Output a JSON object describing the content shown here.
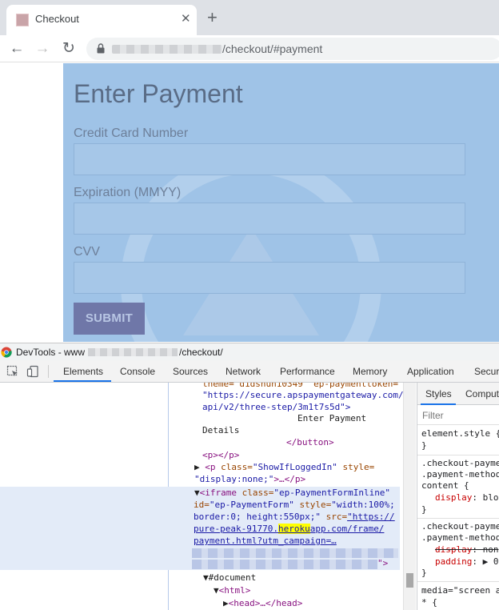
{
  "browser": {
    "tab_title": "Checkout",
    "tab_close": "✕",
    "new_tab": "+",
    "url_path": "/checkout/#payment",
    "nav_back": "←",
    "nav_forward": "→",
    "nav_reload": "↻"
  },
  "page": {
    "title": "Enter Payment",
    "fields": [
      {
        "label": "Credit Card Number",
        "value": ""
      },
      {
        "label": "Expiration (MMYY)",
        "value": ""
      },
      {
        "label": "CVV",
        "value": ""
      }
    ],
    "submit_label": "SUBMIT"
  },
  "devtools": {
    "title_prefix": "DevTools - www",
    "title_suffix": "/checkout/",
    "tabs": [
      "Elements",
      "Console",
      "Sources",
      "Network",
      "Performance",
      "Memory",
      "Application",
      "Securi"
    ],
    "active_tab": "Elements",
    "dom": {
      "l1": "theme=\"d1dshun10349\" ep-paymenttoken=",
      "l2": "\"https://secure.apspaymentgateway.com/",
      "l3": "api/v2/three-step/3m1t7s5d\">",
      "l4": "Enter Payment",
      "l5": "Details",
      "l6": "</button>",
      "l7": "<p></p>",
      "l8_tag": "<p",
      "l8_attr": "class=",
      "l8_val": "\"ShowIfLoggedIn\"",
      "l8_attr2": "style=",
      "l9_val": "\"display:none;\"",
      "l9_rest": ">…</p>",
      "l10_tag": "<iframe",
      "l10_attr": "class=",
      "l10_val": "\"ep-PaymentFormInline\"",
      "l11_attr": "id=",
      "l11_val": "\"ep-PaymentForm\"",
      "l11_attr2": "style=",
      "l11_val2": "\"width:100%;",
      "l12_val": "border:0; height:550px;\"",
      "l12_attr": "src=",
      "l12_link": "\"https://",
      "l13_link_a": "pure-peak-91770.",
      "l13_link_hl": "heroku",
      "l13_link_b": "app.com/frame/",
      "l14_link": "payment.html?utm_campaign=…",
      "l15_end": "\">",
      "l16": "#document",
      "l17": "<html>",
      "l18": "<head>…</head>"
    },
    "styles_tabs": [
      "Styles",
      "Comput"
    ],
    "filter_placeholder": "Filter",
    "styles": {
      "s1": "element.style {",
      "s2": "}",
      "s3": ".checkout-payme",
      "s4": ".payment-method",
      "s5": "content {",
      "s6_prop": "display",
      "s6_val": ": blo",
      "s7": "}",
      "s8": ".checkout-payme",
      "s9": ".payment-method",
      "s10_prop": "display",
      "s10_val": ": non",
      "s11_prop": "padding",
      "s11_val": ": ▶ 0",
      "s12": "}",
      "s13": "media=\"screen a",
      "s14": "* {"
    }
  }
}
